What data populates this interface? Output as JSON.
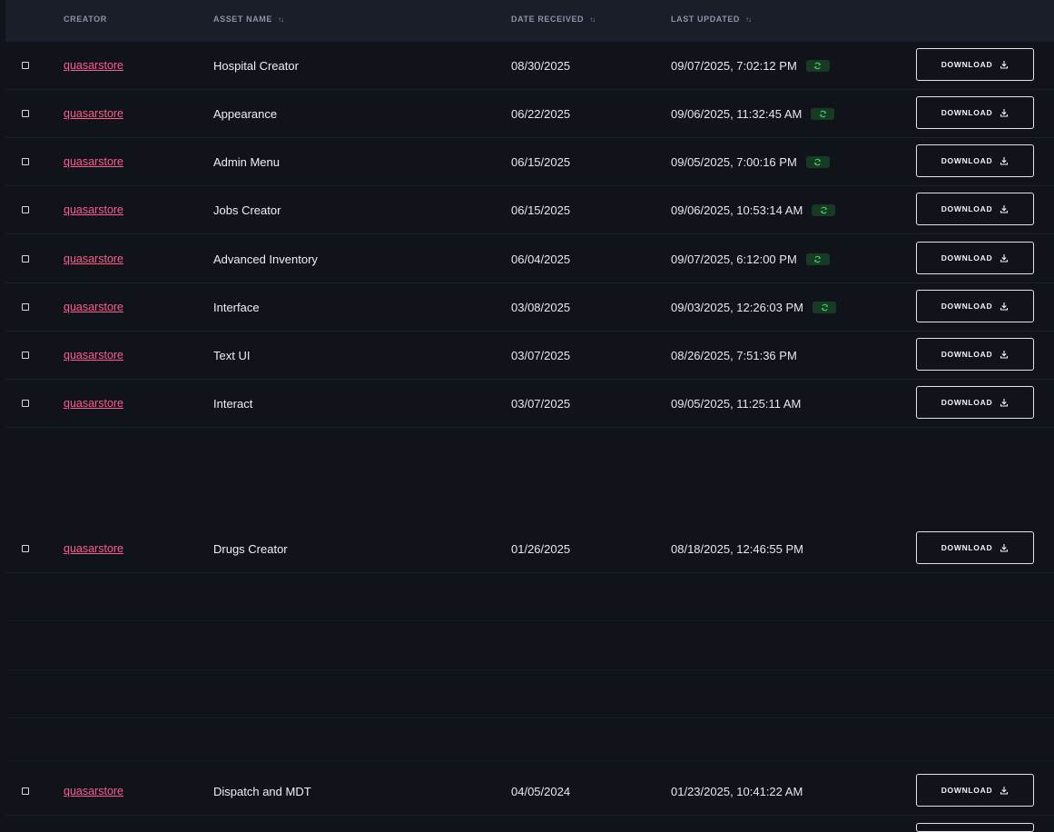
{
  "header": {
    "creator": "CREATOR",
    "asset_name": "ASSET NAME",
    "date_received": "DATE RECEIVED",
    "last_updated": "LAST UPDATED",
    "sort_glyph": "↑↓"
  },
  "download_label": "DOWNLOAD",
  "update_badge_icon": "refresh-icon",
  "colors": {
    "creator_link": "#ff5c8d",
    "badge_bg": "#173a23",
    "badge_fg": "#3ecf6b"
  },
  "rows": [
    {
      "creator": "quasarstore",
      "asset": "Hospital Creator",
      "received": "08/30/2025",
      "updated": "09/07/2025, 7:02:12 PM",
      "has_update": true
    },
    {
      "creator": "quasarstore",
      "asset": "Appearance",
      "received": "06/22/2025",
      "updated": "09/06/2025, 11:32:45 AM",
      "has_update": true
    },
    {
      "creator": "quasarstore",
      "asset": "Admin Menu",
      "received": "06/15/2025",
      "updated": "09/05/2025, 7:00:16 PM",
      "has_update": true
    },
    {
      "creator": "quasarstore",
      "asset": "Jobs Creator",
      "received": "06/15/2025",
      "updated": "09/06/2025, 10:53:14 AM",
      "has_update": true
    },
    {
      "creator": "quasarstore",
      "asset": "Advanced Inventory",
      "received": "06/04/2025",
      "updated": "09/07/2025, 6:12:00 PM",
      "has_update": true
    },
    {
      "creator": "quasarstore",
      "asset": "Interface",
      "received": "03/08/2025",
      "updated": "09/03/2025, 12:26:03 PM",
      "has_update": true
    },
    {
      "creator": "quasarstore",
      "asset": "Text UI",
      "received": "03/07/2025",
      "updated": "08/26/2025, 7:51:36 PM",
      "has_update": false
    },
    {
      "creator": "quasarstore",
      "asset": "Interact",
      "received": "03/07/2025",
      "updated": "09/05/2025, 11:25:11 AM",
      "has_update": false
    },
    {
      "creator": "quasarstore",
      "asset": "Drugs Creator",
      "received": "01/26/2025",
      "updated": "08/18/2025, 12:46:55 PM",
      "has_update": false
    },
    {
      "creator": "quasarstore",
      "asset": "Dispatch and MDT",
      "received": "04/05/2024",
      "updated": "01/23/2025, 10:41:22 AM",
      "has_update": false
    }
  ]
}
